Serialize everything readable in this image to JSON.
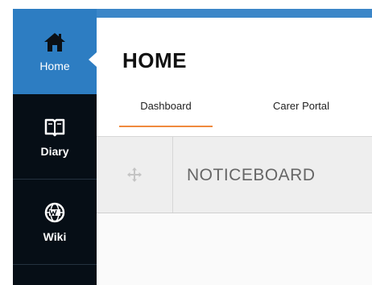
{
  "sidebar": {
    "items": [
      {
        "label": "Home",
        "icon": "home-icon",
        "active": true
      },
      {
        "label": "Diary",
        "icon": "book-icon",
        "active": false
      },
      {
        "label": "Wiki",
        "icon": "globe-w-icon",
        "active": false
      }
    ]
  },
  "header": {
    "title": "HOME"
  },
  "tabs": [
    {
      "label": "Dashboard",
      "active": true
    },
    {
      "label": "Carer Portal",
      "active": false
    }
  ],
  "noticeboard": {
    "title": "NOTICEBOARD",
    "handle_icon": "move-icon"
  },
  "colors": {
    "sidebar_bg": "#060e16",
    "active_nav": "#2d7dc2",
    "top_bar": "#3b86c8",
    "tab_underline": "#f08a3e"
  }
}
